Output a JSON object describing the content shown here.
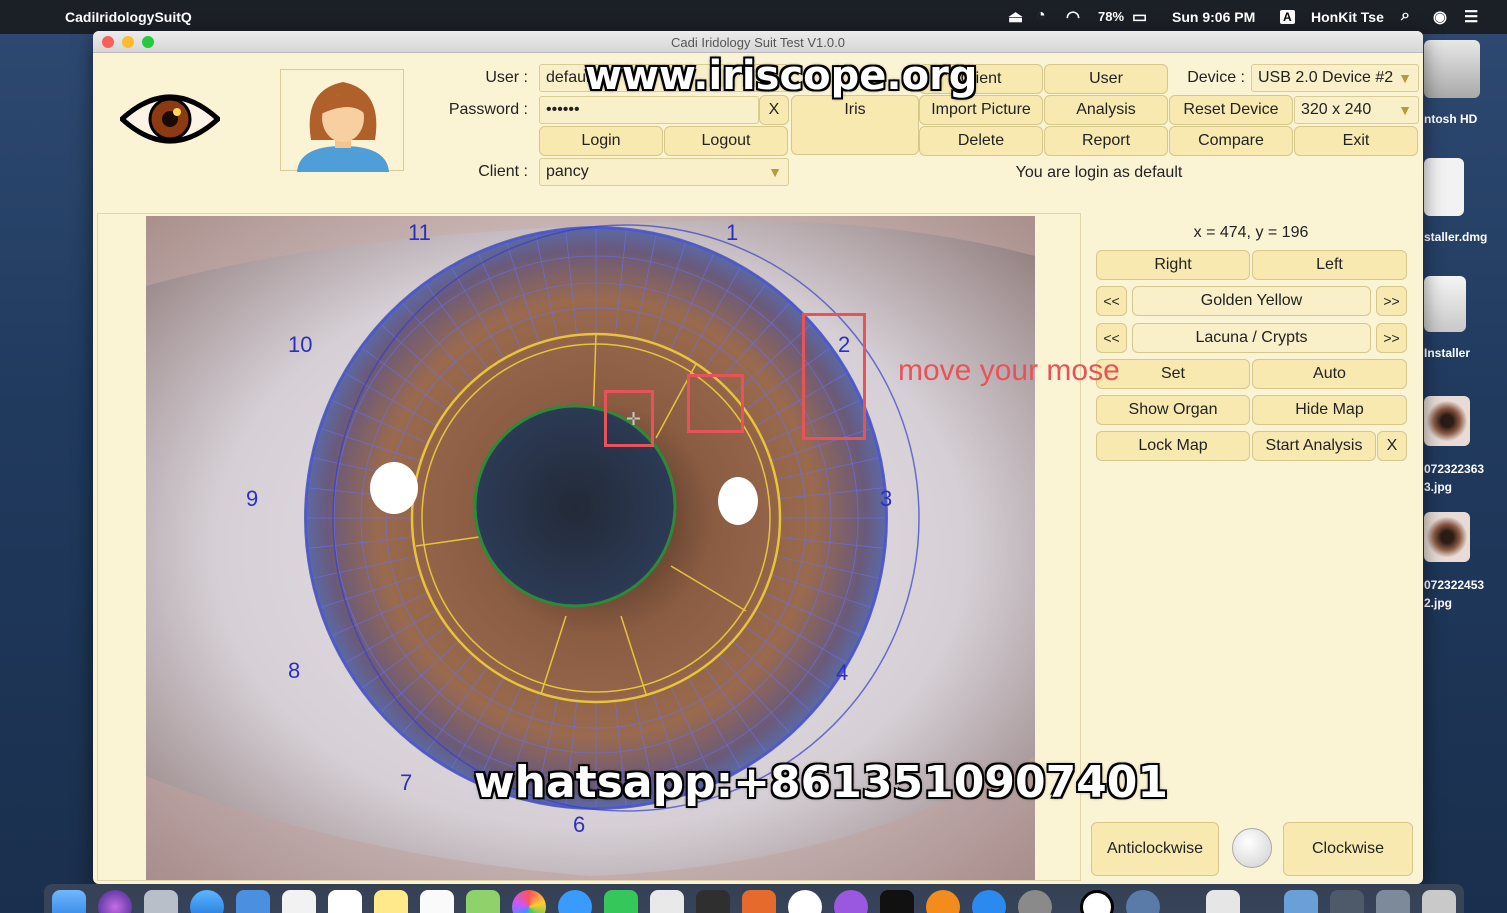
{
  "menubar": {
    "app_name": "CadiIridologySuitQ",
    "battery": "78%",
    "clock": "Sun 9:06 PM",
    "input_source": "A",
    "user": "HonKit Tse"
  },
  "desktop": {
    "icons": [
      {
        "label": "ntosh HD",
        "icon": "hard-drive-icon"
      },
      {
        "label": "staller.dmg",
        "icon": "dmg-icon"
      },
      {
        "label": "Installer",
        "icon": "installer-icon"
      },
      {
        "label1": "072322363",
        "label2": "3.jpg",
        "icon": "image-file-icon"
      },
      {
        "label1": "072322453",
        "label2": "2.jpg",
        "icon": "image-file-icon"
      }
    ]
  },
  "window": {
    "title": "Cadi Iridology Suit Test V1.0.0"
  },
  "login": {
    "user_label": "User :",
    "user_value": "default",
    "password_label": "Password :",
    "password_value": "••••••",
    "clear_label": "X",
    "login_label": "Login",
    "logout_label": "Logout",
    "client_label": "Client :",
    "client_value": "pancy"
  },
  "toolbar": {
    "iris": "Iris",
    "client": "Client",
    "user": "User",
    "import_picture": "Import Picture",
    "analysis": "Analysis",
    "delete": "Delete",
    "report": "Report",
    "reset_device": "Reset Device",
    "compare": "Compare",
    "exit": "Exit",
    "device_label": "Device :",
    "device_value": "USB 2.0 Device #2",
    "resolution_value": "320 x 240",
    "status": "You are login as default"
  },
  "iris_map": {
    "clock_numbers": [
      "1",
      "2",
      "3",
      "4",
      "6",
      "7",
      "8",
      "9",
      "10",
      "11"
    ]
  },
  "side": {
    "coord": "x = 474, y = 196",
    "right": "Right",
    "left": "Left",
    "prev": "<<",
    "next": ">>",
    "color_value": "Golden Yellow",
    "feature_value": "Lacuna / Crypts",
    "set": "Set",
    "auto": "Auto",
    "show_organ": "Show Organ",
    "hide_map": "Hide Map",
    "lock_map": "Lock Map",
    "start_analysis": "Start Analysis",
    "close": "X",
    "anticlockwise": "Anticlockwise",
    "clockwise": "Clockwise"
  },
  "overlay": {
    "watermark_top": "www.iriscope.org",
    "watermark_bottom": "whatsapp:+8613510907401",
    "instruction": "move your mose"
  },
  "colors": {
    "window_bg": "#fbf4d4",
    "button_bg": "#f7e9b0",
    "annotation_red": "#e8535a",
    "map_blue": "#5a5ee0",
    "ring_yellow": "#e8c43a"
  }
}
